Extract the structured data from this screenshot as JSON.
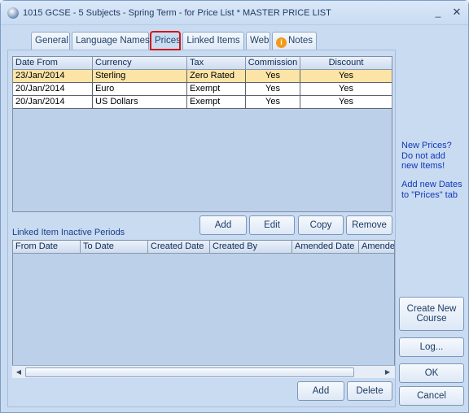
{
  "window": {
    "title": "1015 GCSE - 5 Subjects - Spring Term - for Price List * MASTER PRICE LIST",
    "minimize": "_",
    "close": "✕"
  },
  "tabs": [
    {
      "label": "General"
    },
    {
      "label": "Language Names"
    },
    {
      "label": "Prices"
    },
    {
      "label": "Linked Items"
    },
    {
      "label": "Web"
    },
    {
      "label": "Notes"
    }
  ],
  "prices": {
    "headers": [
      "Date From",
      "Currency",
      "Tax",
      "Commission",
      "Discount"
    ],
    "rows": [
      [
        "23/Jan/2014",
        "Sterling",
        "Zero Rated",
        "Yes",
        "Yes"
      ],
      [
        "20/Jan/2014",
        "Euro",
        "Exempt",
        "Yes",
        "Yes"
      ],
      [
        "20/Jan/2014",
        "US Dollars",
        "Exempt",
        "Yes",
        "Yes"
      ]
    ],
    "buttons": {
      "add": "Add",
      "edit": "Edit",
      "copy": "Copy",
      "remove": "Remove"
    }
  },
  "inactive": {
    "title": "Linked Item Inactive Periods",
    "headers": [
      "From Date",
      "To Date",
      "Created Date",
      "Created By",
      "Amended Date",
      "Amende"
    ],
    "buttons": {
      "add": "Add",
      "delete": "Delete"
    }
  },
  "side": {
    "hint1": [
      "New Prices?",
      "Do not add",
      "new Items!"
    ],
    "hint2": [
      "Add new Dates",
      "to \"Prices\" tab"
    ],
    "create_course": [
      "Create New",
      "Course"
    ],
    "log": "Log...",
    "ok": "OK",
    "cancel": "Cancel"
  }
}
